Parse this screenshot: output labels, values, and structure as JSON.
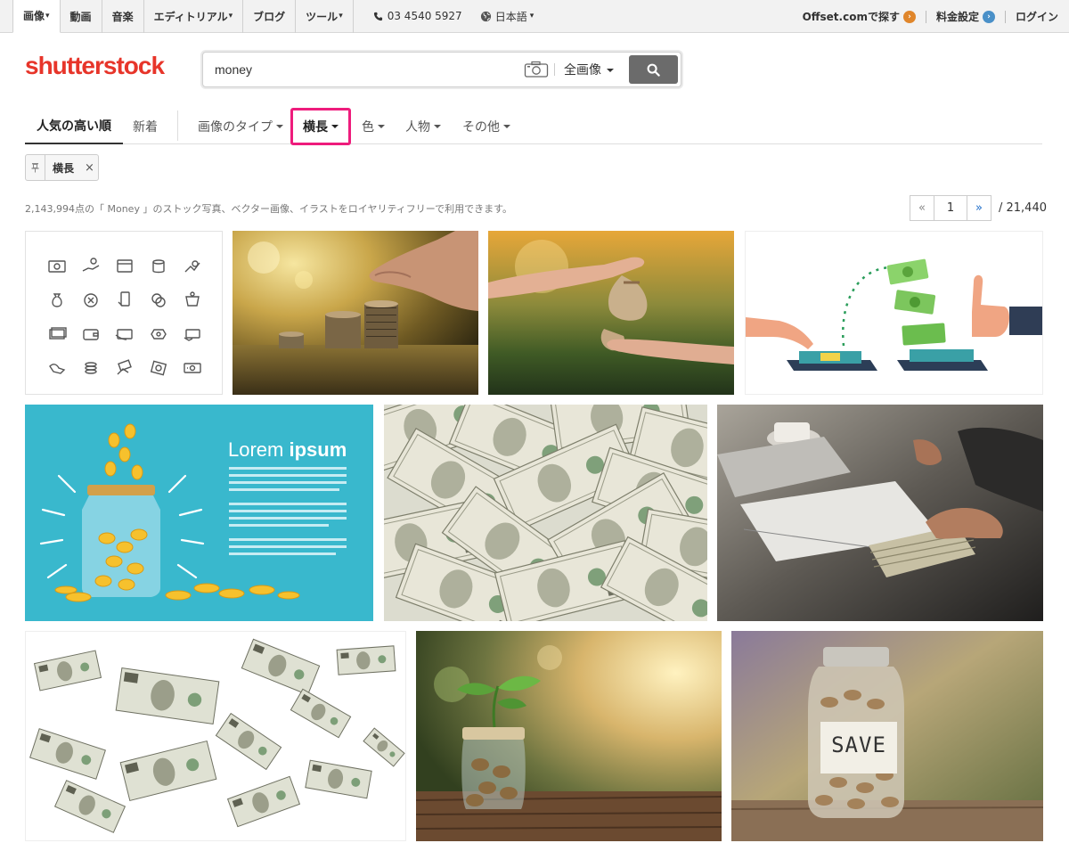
{
  "topnav": {
    "tabs": [
      {
        "label": "画像",
        "caret": "▾"
      },
      {
        "label": "動画",
        "caret": ""
      },
      {
        "label": "音楽",
        "caret": ""
      },
      {
        "label": "エディトリアル",
        "caret": "▾"
      },
      {
        "label": "ブログ",
        "caret": ""
      },
      {
        "label": "ツール",
        "caret": "▾"
      }
    ],
    "phone": "03 4540 5927",
    "language": "日本語",
    "language_caret": "▾",
    "offset_link": "Offset.comで探す",
    "pricing": "料金設定",
    "login": "ログイン"
  },
  "logo": "shutterstock",
  "search": {
    "value": "money",
    "scope": "全画像"
  },
  "filters": {
    "sort_popular": "人気の高い順",
    "sort_new": "新着",
    "image_type": "画像のタイプ",
    "orientation": "横長",
    "color": "色",
    "people": "人物",
    "more": "その他"
  },
  "active_chip": {
    "label": "横長",
    "remove": "×"
  },
  "results": {
    "count_text": "2,143,994点の「 Money 」のストック写真、ベクター画像、イラストをロイヤリティフリーで利用できます。",
    "page_prev": "«",
    "page": "1",
    "page_next": "»",
    "total_pages": "/ 21,440"
  },
  "thumbs": {
    "lorem_title": "Lorem",
    "lorem_bold": "ipsum",
    "save_label": "SAVE"
  },
  "colors": {
    "brand": "#e7352a",
    "highlight": "#ee1c7c",
    "link_blue": "#1e6dc9"
  }
}
